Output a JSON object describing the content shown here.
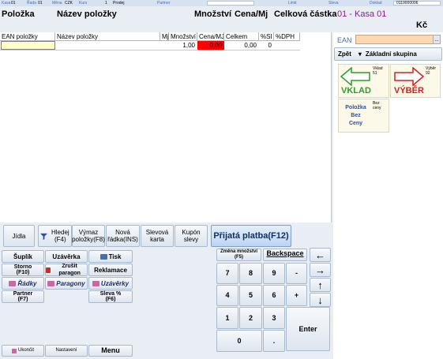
{
  "status_bar": {
    "kasa_label": "Kasa",
    "kasa_value": "01",
    "rada_label": "Řada",
    "rada_value": "01",
    "mena_label": "Měna",
    "mena_value": "CZK",
    "kurs_label": "Kurs",
    "kurs_value": "1",
    "mode_value": "Prodej",
    "partner_label": "Partner",
    "limit_label": "Limit",
    "sleva_label": "Sleva",
    "doklad_label": "Doklad",
    "doklad_value": "0119000006"
  },
  "header": {
    "polozka": "Položka",
    "nazev": "Název položky",
    "mnozstvi": "Množství",
    "cena": "Cena/Mj",
    "celkova": "Celková částka",
    "kasa": "01 - Kasa 01",
    "currency": "Kč"
  },
  "grid": {
    "columns": [
      "EAN položky",
      "Název položky",
      "Mj",
      "Množství",
      "Cena/MJ",
      "Celkem",
      "%SI",
      "%DPH"
    ],
    "row": {
      "ean": "",
      "name": "",
      "mj": "",
      "qty": "1,00",
      "price": "0,00",
      "total": "0,00",
      "si": "0",
      "dph": ""
    }
  },
  "function_buttons": {
    "jidla": "Jídla",
    "hledej": "Hledej\n(F4)",
    "vymaz": "Výmaz\npoložky(F8)",
    "nova": "Nová\nřádka(INS)",
    "slevova": "Slevová\nkarta",
    "kupon": "Kupón\nslevy",
    "platba": "Přijatá platba(F12)"
  },
  "commands": {
    "suplik": "Šuplík",
    "uzaverka": "Uzávěrka",
    "tisk": "Tisk",
    "storno": "Storno\n(F10)",
    "zrusit": "Zrušit paragon",
    "reklamace": "Reklamace",
    "radky": "Řádky",
    "paragony": "Paragony",
    "uzaverky": "Uzávěrky",
    "partner": "Partner\n(F7)",
    "sleva": "Sleva %\n(F6)",
    "ukoncit": "Ukončit",
    "nastaveni": "Nastavení",
    "menu": "Menu"
  },
  "keypad": {
    "zmena": "Změna množství\n(F5)",
    "backspace": "Backspace",
    "k7": "7",
    "k8": "8",
    "k9": "9",
    "minus": "-",
    "k4": "4",
    "k5": "5",
    "k6": "6",
    "plus": "+",
    "k1": "1",
    "k2": "2",
    "k3": "3",
    "k0": "0",
    "dot": ".",
    "enter": "Enter",
    "left": "←",
    "right": "→",
    "up": "↑",
    "down": "↓"
  },
  "right_panel": {
    "ean_label": "EAN",
    "ean_value": "",
    "ean_more": "..",
    "zpet": "Zpět",
    "group": "Základní skupina",
    "vklad_small": "Vklad\n51",
    "vklad_label": "VKLAD",
    "vyber_small": "Výběr\n92",
    "vyber_label": "VÝBĚR",
    "polozka_bez_ceny": "Položka\nBez\nCeny",
    "bez_ceny_small": "Bez\nceny"
  },
  "colors": {
    "accent": "#8b1e8b",
    "vklad_green": "#2aa02a",
    "vyber_red": "#d22020",
    "price_cell": "#ff0000",
    "ean_input": "#fbd9b4"
  }
}
